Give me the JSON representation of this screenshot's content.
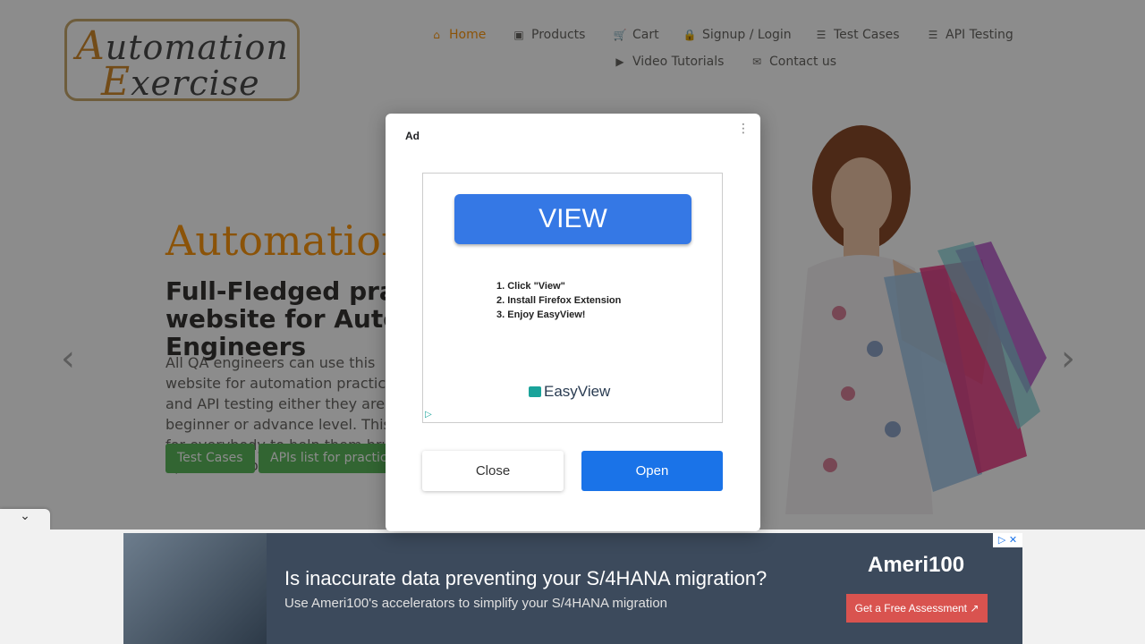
{
  "logo": {
    "line1_cap": "A",
    "line1_rest": "utomation",
    "line2_cap": "E",
    "line2_rest": "xercise"
  },
  "nav": [
    {
      "label": "Home",
      "icon": "home-icon",
      "glyph": "⌂",
      "active": true
    },
    {
      "label": "Products",
      "icon": "briefcase-icon",
      "glyph": "▣",
      "active": false
    },
    {
      "label": "Cart",
      "icon": "cart-icon",
      "glyph": "🛒",
      "active": false
    },
    {
      "label": "Signup / Login",
      "icon": "lock-icon",
      "glyph": "🔒",
      "active": false
    },
    {
      "label": "Test Cases",
      "icon": "list-icon",
      "glyph": "☰",
      "active": false
    },
    {
      "label": "API Testing",
      "icon": "list-icon",
      "glyph": "☰",
      "active": false
    },
    {
      "label": "Video Tutorials",
      "icon": "youtube-icon",
      "glyph": "▶",
      "active": false
    },
    {
      "label": "Contact us",
      "icon": "envelope-icon",
      "glyph": "✉",
      "active": false
    }
  ],
  "hero": {
    "title": "Automation",
    "subtitle": "Full-Fledged practice website for Automation Engineers",
    "text": "All QA engineers can use this website for automation practice and API testing either they are at beginner or advance level. This is for everybody to help them brush up their automation skills.",
    "test_cases_button": "Test Cases",
    "apis_button": "APIs list for practice",
    "prev_arrow": "‹",
    "next_arrow": "›"
  },
  "ad_dialog": {
    "label": "Ad",
    "menu_glyph": "⋮",
    "view_button": "VIEW",
    "steps": [
      "1. Click \"View\"",
      "2. Install Firefox Extension",
      "3. Enjoy EasyView!"
    ],
    "brand": "EasyView",
    "adchoices_glyph": "▷",
    "close_button": "Close",
    "open_button": "Open"
  },
  "bottom_ad": {
    "headline": "Is inaccurate data preventing your S/4HANA migration?",
    "subline": "Use Ameri100's accelerators to simplify your S/4HANA migration",
    "brand": "Ameri100",
    "cta": "Get a Free Assessment ↗",
    "close_glyph": "▷ ✕",
    "collapse_glyph": "⌄"
  },
  "colors": {
    "accent": "#fe980f",
    "green": "#5cb85c",
    "primary_blue": "#1a73e8",
    "view_blue": "#3578e5"
  }
}
